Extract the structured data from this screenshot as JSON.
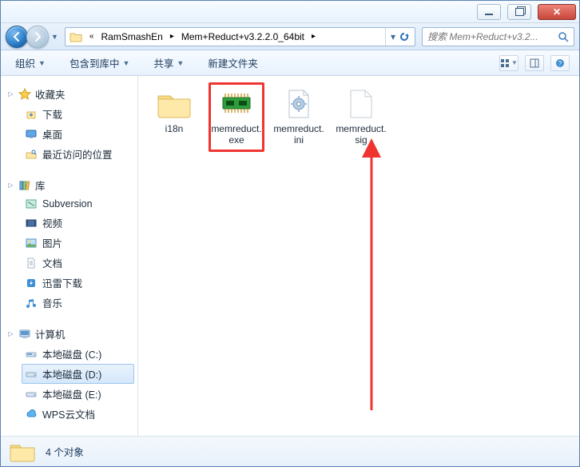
{
  "titlebar": {},
  "nav": {
    "back_arrow": "←",
    "fwd_arrow": "→",
    "breadcrumbs": [
      "RamSmashEn",
      "Mem+Reduct+v3.2.2.0_64bit"
    ],
    "search_placeholder": "搜索 Mem+Reduct+v3.2..."
  },
  "toolbar": {
    "organize": "组织",
    "include": "包含到库中",
    "share": "共享",
    "newfolder": "新建文件夹"
  },
  "sidebar": {
    "favorites": {
      "label": "收藏夹",
      "items": [
        "下载",
        "桌面",
        "最近访问的位置"
      ],
      "icons": [
        "download",
        "desktop",
        "recent"
      ]
    },
    "libraries": {
      "label": "库",
      "items": [
        "Subversion",
        "视频",
        "图片",
        "文档",
        "迅雷下载",
        "音乐"
      ],
      "icons": [
        "subv",
        "video",
        "pic",
        "doc",
        "xunlei",
        "music"
      ]
    },
    "computer": {
      "label": "计算机",
      "items": [
        "本地磁盘 (C:)",
        "本地磁盘 (D:)",
        "本地磁盘 (E:)",
        "WPS云文档"
      ],
      "icons": [
        "diskc",
        "disk",
        "disk",
        "cloud"
      ],
      "selected_index": 1
    }
  },
  "files": [
    {
      "name": "i18n",
      "type": "folder"
    },
    {
      "name": "memreduct.exe",
      "type": "exe",
      "highlight": true
    },
    {
      "name": "memreduct.ini",
      "type": "ini"
    },
    {
      "name": "memreduct.sig",
      "type": "sig"
    }
  ],
  "status": {
    "text": "4 个对象"
  }
}
